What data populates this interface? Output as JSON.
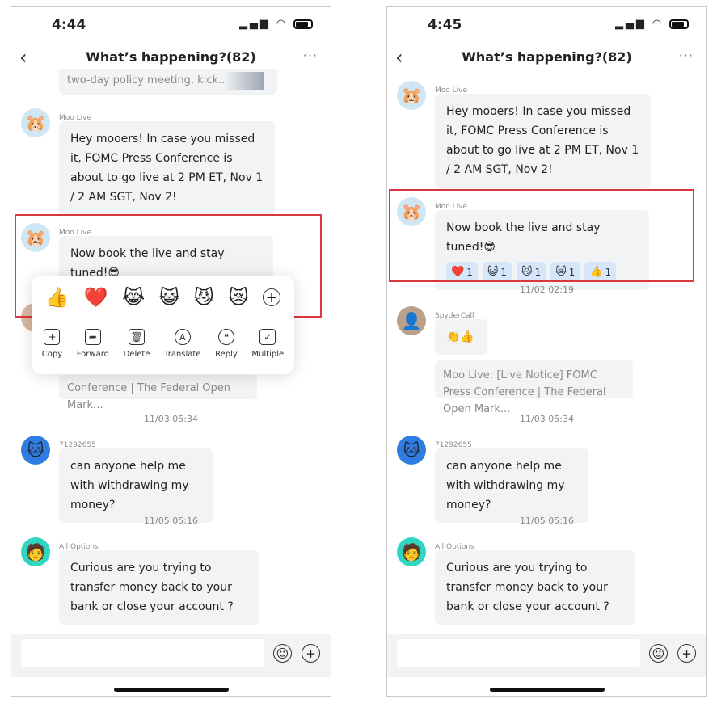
{
  "screens": [
    {
      "status_time": "4:44",
      "title": "What’s happening?(82)",
      "quote_top": "two-day policy meeting, kick...",
      "messages": [
        {
          "sender": "Moo Live",
          "avatar": "moo-cat-avatar",
          "text": "Hey mooers! In case you missed it, FOMC Press Conference is about to go live at 2 PM ET, Nov 1 / 2 AM SGT, Nov 2!"
        },
        {
          "sender": "Moo Live",
          "avatar": "moo-cat-avatar",
          "text": "Now book the live and stay tuned!😎"
        }
      ],
      "quote_bottom": "Conference | The Federal Open Mark...",
      "popup": {
        "reactions": [
          "👍",
          "❤️",
          "😹",
          "😺",
          "😼",
          "😿"
        ],
        "add_icon": "plus-circle-icon",
        "actions": [
          {
            "label": "Copy",
            "icon": "copy-icon",
            "glyph": "+"
          },
          {
            "label": "Forward",
            "icon": "forward-icon",
            "glyph": "➦"
          },
          {
            "label": "Delete",
            "icon": "trash-icon",
            "glyph": "🗑"
          },
          {
            "label": "Translate",
            "icon": "translate-icon",
            "glyph": "A"
          },
          {
            "label": "Reply",
            "icon": "reply-quote-icon",
            "glyph": "❝"
          },
          {
            "label": "Multiple",
            "icon": "multi-select-icon",
            "glyph": "✓"
          }
        ]
      }
    },
    {
      "status_time": "4:45",
      "title": "What’s happening?(82)",
      "messages": [
        {
          "sender": "Moo Live",
          "avatar": "moo-cat-avatar",
          "text": "Hey mooers! In case you missed it, FOMC Press Conference is about to go live at 2 PM ET, Nov 1 / 2 AM SGT, Nov 2!"
        },
        {
          "sender": "Moo Live",
          "avatar": "moo-cat-avatar",
          "text": "Now book the live and stay tuned!😎",
          "reactions": [
            {
              "emoji": "❤️",
              "count": "1"
            },
            {
              "emoji": "😺",
              "count": "1"
            },
            {
              "emoji": "😼",
              "count": "1"
            },
            {
              "emoji": "😿",
              "count": "1"
            },
            {
              "emoji": "👍",
              "count": "1"
            }
          ]
        }
      ],
      "timestamp_1": "11/02 02:19",
      "spyder": {
        "sender": "SpyderCall",
        "text": "👏👍",
        "quote": "Moo Live: [Live Notice] FOMC Press Conference | The Federal Open Mark..."
      }
    }
  ],
  "shared": {
    "timestamp_2": "11/03 05:34",
    "timestamp_3": "11/05 05:16",
    "msg_user": {
      "sender": "71292655",
      "text": "can anyone help me with withdrawing my money?"
    },
    "msg_options": {
      "sender": "All Options",
      "text": "Curious are you trying to transfer money back to your bank or close your account ?"
    },
    "input_placeholder": "",
    "highlight_color": "#d9363e"
  }
}
